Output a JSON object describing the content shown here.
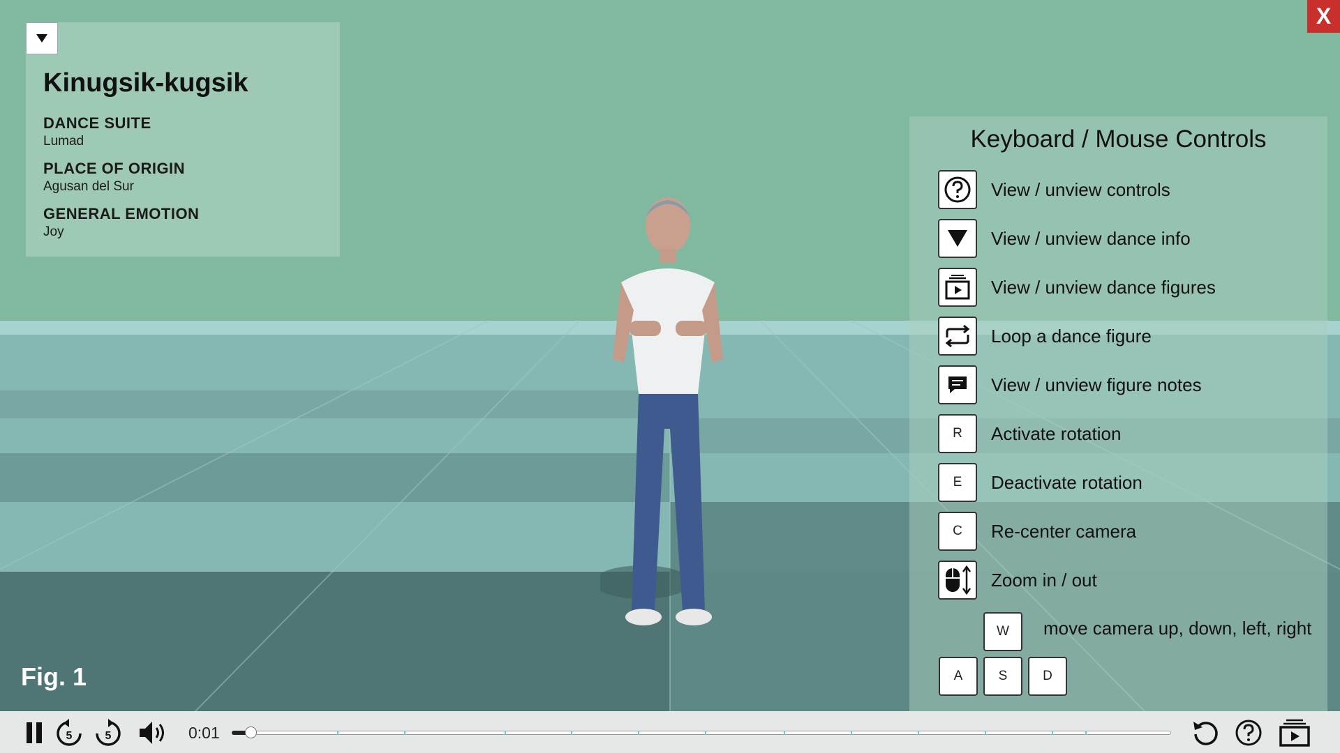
{
  "dance": {
    "title": "Kinugsik-kugsik",
    "fields": [
      {
        "label": "DANCE SUITE",
        "value": "Lumad"
      },
      {
        "label": "PLACE OF ORIGIN",
        "value": "Agusan del Sur"
      },
      {
        "label": "GENERAL EMOTION",
        "value": "Joy"
      }
    ]
  },
  "close_label": "X",
  "figure_label": "Fig. 1",
  "controls": {
    "title": "Keyboard / Mouse Controls",
    "items": [
      {
        "icon": "question-icon",
        "label": "View / unview controls"
      },
      {
        "icon": "triangle-down-icon",
        "label": "View / unview dance info"
      },
      {
        "icon": "figures-icon",
        "label": "View / unview dance figures"
      },
      {
        "icon": "loop-icon",
        "label": "Loop a dance figure"
      },
      {
        "icon": "notes-icon",
        "label": "View / unview figure notes"
      },
      {
        "key": "R",
        "label": "Activate rotation"
      },
      {
        "key": "E",
        "label": "Deactivate rotation"
      },
      {
        "key": "C",
        "label": "Re-center camera"
      },
      {
        "icon": "mouse-scroll-icon",
        "label": "Zoom in / out"
      }
    ],
    "move": {
      "keys": [
        "W",
        "A",
        "S",
        "D"
      ],
      "label": "move camera up, down, left, right"
    }
  },
  "player": {
    "time": "0:01",
    "progress": 0.02,
    "rewind_seconds": "5",
    "forward_seconds": "5",
    "buttons": [
      "pause-icon",
      "rewind-5-icon",
      "forward-5-icon",
      "volume-icon",
      "replay-icon",
      "help-icon",
      "figures-icon"
    ]
  }
}
